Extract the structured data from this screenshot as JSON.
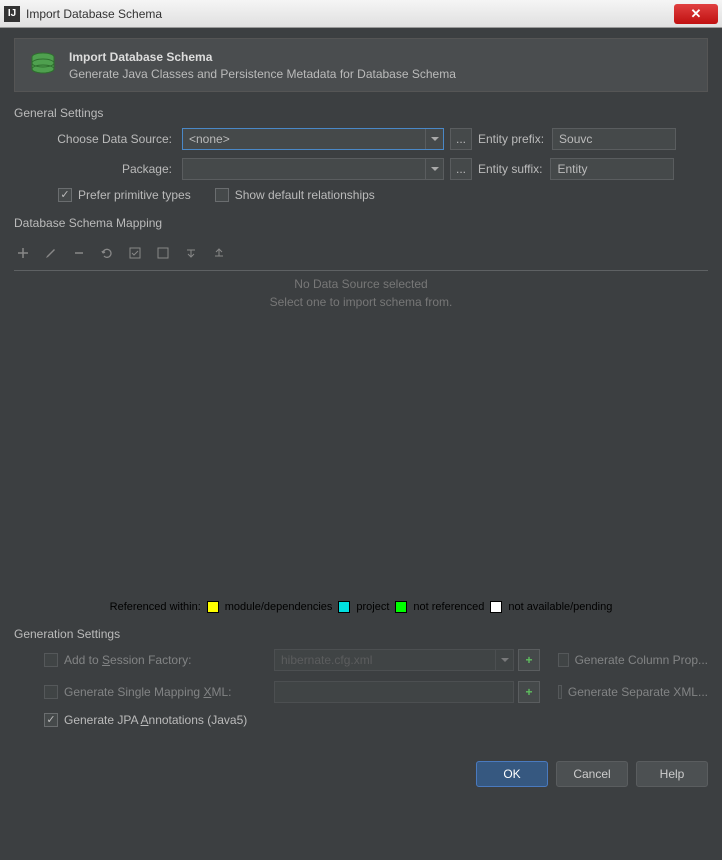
{
  "window": {
    "title": "Import Database Schema"
  },
  "banner": {
    "title": "Import Database Schema",
    "subtitle": "Generate Java Classes and Persistence Metadata for Database Schema"
  },
  "general": {
    "section_label": "General Settings",
    "data_source_label": "Choose Data Source:",
    "data_source_value": "<none>",
    "package_label": "Package:",
    "package_value": "",
    "entity_prefix_label": "Entity prefix:",
    "entity_prefix_value": "Souvc",
    "entity_suffix_label": "Entity suffix:",
    "entity_suffix_value": "Entity",
    "prefer_primitive_label": "Prefer primitive types",
    "show_default_rel_label": "Show default relationships"
  },
  "schema": {
    "section_label": "Database Schema Mapping",
    "placeholder_line1": "No Data Source selected",
    "placeholder_line2": "Select one to import schema from."
  },
  "legend": {
    "prefix": "Referenced within:",
    "items": [
      {
        "color": "yellow",
        "label": "module/dependencies"
      },
      {
        "color": "cyan",
        "label": "project"
      },
      {
        "color": "green",
        "label": "not referenced"
      },
      {
        "color": "white",
        "label": "not available/pending"
      }
    ]
  },
  "generation": {
    "section_label": "Generation Settings",
    "add_session_label": "Add to Session Factory:",
    "add_session_value": "hibernate.cfg.xml",
    "single_xml_label": "Generate Single Mapping XML:",
    "single_xml_value": "",
    "jpa_label": "Generate JPA Annotations (Java5)",
    "column_prop_label": "Generate Column Prop...",
    "separate_xml_label": "Generate Separate XML..."
  },
  "buttons": {
    "ok": "OK",
    "cancel": "Cancel",
    "help": "Help"
  }
}
